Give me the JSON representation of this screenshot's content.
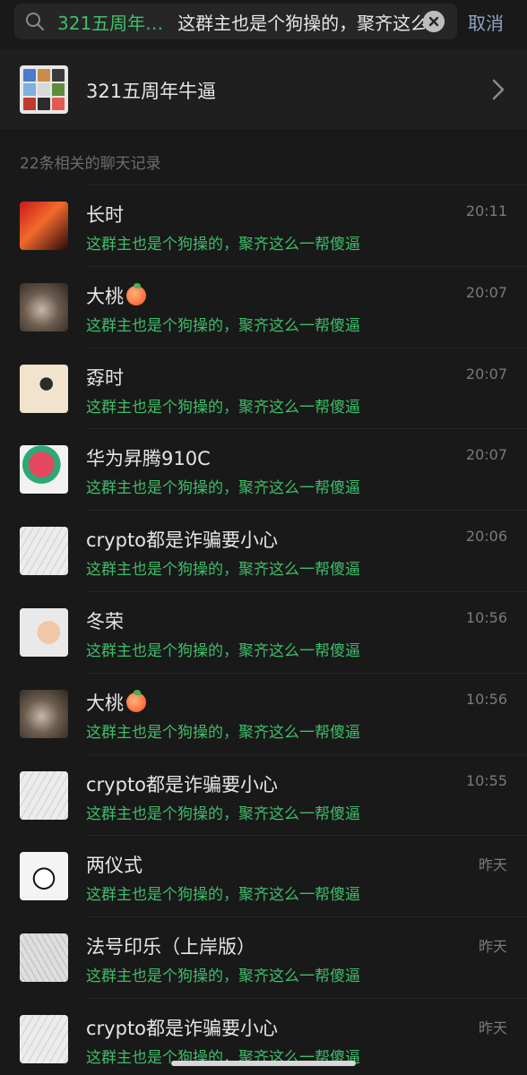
{
  "search": {
    "chat_name": "321五周年…",
    "query": "这群主也是个狗操的，聚齐这么",
    "cancel_label": "取消"
  },
  "group": {
    "name": "321五周年牛逼"
  },
  "section": {
    "header": "22条相关的聊天记录"
  },
  "results": [
    {
      "name": "长时",
      "preview": "这群主也是个狗操的，聚齐这么一帮傻逼",
      "time": "20:11",
      "avatar": "red-anime-avatar",
      "emoji": false
    },
    {
      "name": "大桃",
      "preview": "这群主也是个狗操的，聚齐这么一帮傻逼",
      "time": "20:07",
      "avatar": "cat-avatar",
      "emoji": true
    },
    {
      "name": "孬时",
      "preview": "这群主也是个狗操的，聚齐这么一帮傻逼",
      "time": "20:07",
      "avatar": "cream-avatar",
      "emoji": false
    },
    {
      "name": "华为昇腾910C",
      "preview": "这群主也是个狗操的，聚齐这么一帮傻逼",
      "time": "20:07",
      "avatar": "anime-avatar",
      "emoji": false
    },
    {
      "name": "crypto都是诈骗要小心",
      "preview": "这群主也是个狗操的，聚齐这么一帮傻逼",
      "time": "20:06",
      "avatar": "sketch-avatar",
      "emoji": false
    },
    {
      "name": "冬荣",
      "preview": "这群主也是个狗操的，聚齐这么一帮傻逼",
      "time": "10:56",
      "avatar": "baby-avatar",
      "emoji": false
    },
    {
      "name": "大桃",
      "preview": "这群主也是个狗操的，聚齐这么一帮傻逼",
      "time": "10:56",
      "avatar": "cat-avatar",
      "emoji": true
    },
    {
      "name": "crypto都是诈骗要小心",
      "preview": "这群主也是个狗操的，聚齐这么一帮傻逼",
      "time": "10:55",
      "avatar": "sketch-avatar",
      "emoji": false
    },
    {
      "name": "两仪式",
      "preview": "这群主也是个狗操的，聚齐这么一帮傻逼",
      "time": "昨天",
      "avatar": "chibi-avatar",
      "emoji": false
    },
    {
      "name": "法号印乐（上岸版）",
      "preview": "这群主也是个狗操的，聚齐这么一帮傻逼",
      "time": "昨天",
      "avatar": "pencil-avatar",
      "emoji": false
    },
    {
      "name": "crypto都是诈骗要小心",
      "preview": "这群主也是个狗操的，聚齐这么一帮傻逼",
      "time": "昨天",
      "avatar": "sketch-avatar",
      "emoji": false
    }
  ],
  "colors": {
    "background": "#191919",
    "highlight_green": "#3fbd6a",
    "cancel_blue": "#8fa4c3"
  }
}
